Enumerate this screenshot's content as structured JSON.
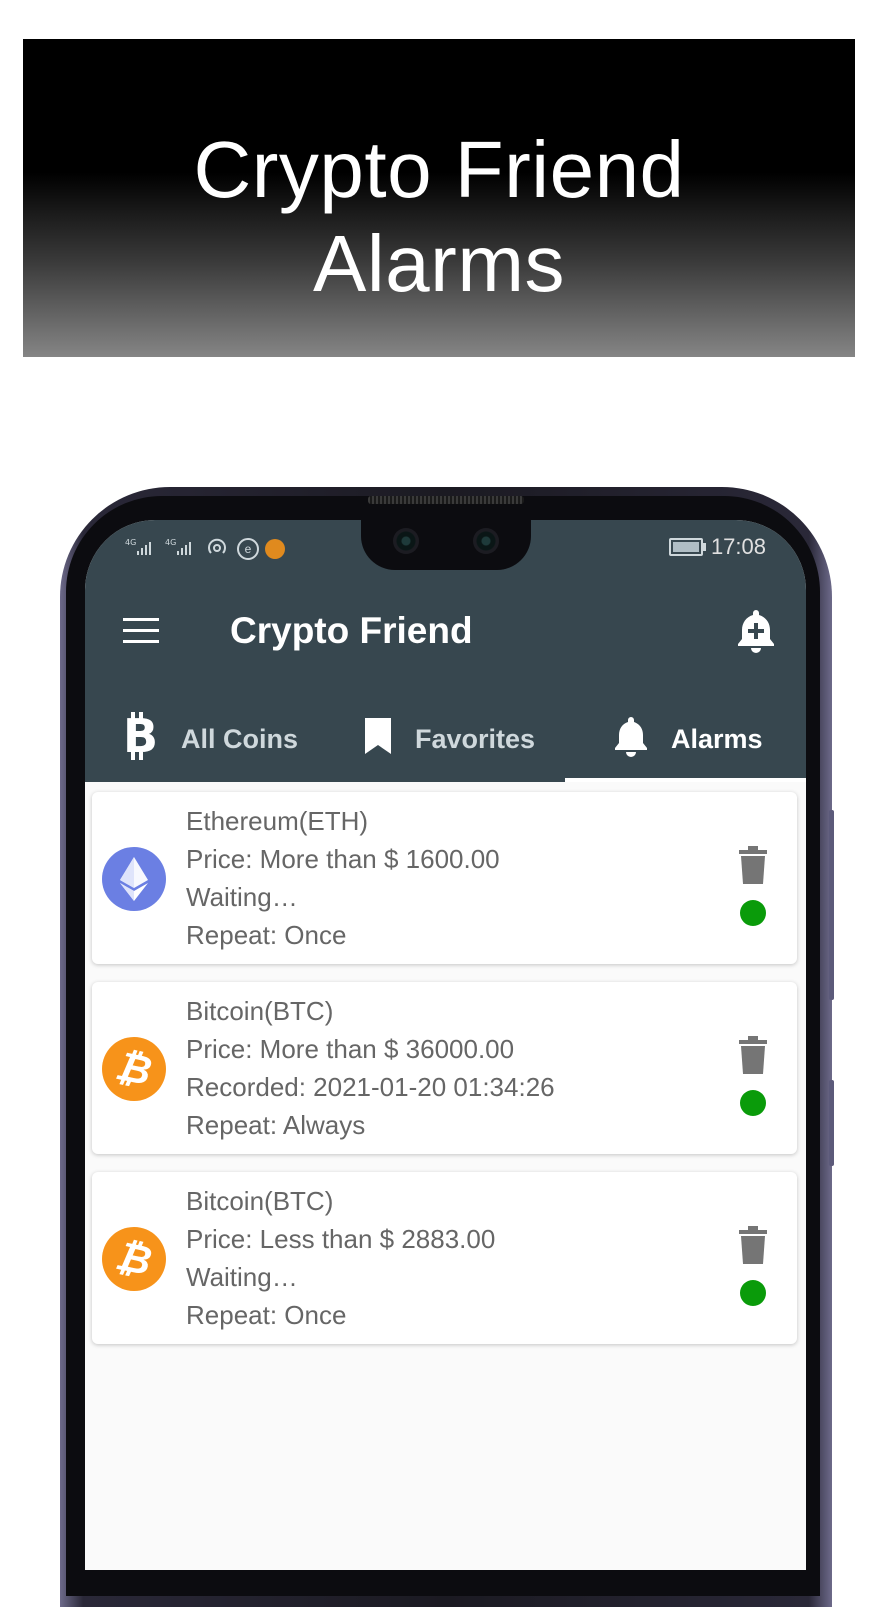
{
  "banner": {
    "line1": "Crypto Friend",
    "line2": "Alarms"
  },
  "status_bar": {
    "signal1": "4G",
    "signal2": "4G",
    "e_icon": "e",
    "time": "17:08"
  },
  "app_bar": {
    "title": "Crypto Friend",
    "menu_icon": "hamburger-menu-icon",
    "add_alarm_icon": "bell-plus-icon"
  },
  "tabs": [
    {
      "label": "All Coins",
      "icon": "bitcoin-icon"
    },
    {
      "label": "Favorites",
      "icon": "bookmark-icon"
    },
    {
      "label": "Alarms",
      "icon": "bell-icon",
      "active": true
    }
  ],
  "alarms": [
    {
      "coin": "Ethereum(ETH)",
      "price": "Price: More than $ 1600.00",
      "status": "Waiting…",
      "repeat": "Repeat: Once",
      "icon": "ethereum-icon"
    },
    {
      "coin": "Bitcoin(BTC)",
      "price": "Price: More than $ 36000.00",
      "status": "Recorded: 2021-01-20 01:34:26",
      "repeat": "Repeat: Always",
      "icon": "bitcoin-icon",
      "symbol": "₿"
    },
    {
      "coin": "Bitcoin(BTC)",
      "price": "Price: Less than $ 2883.00",
      "status": "Waiting…",
      "repeat": "Repeat: Once",
      "icon": "bitcoin-icon",
      "symbol": "₿"
    }
  ],
  "colors": {
    "appbar": "#37474f",
    "active_dot": "#0a9b0a",
    "bitcoin": "#f7931a",
    "ethereum": "#6b7fe3"
  }
}
